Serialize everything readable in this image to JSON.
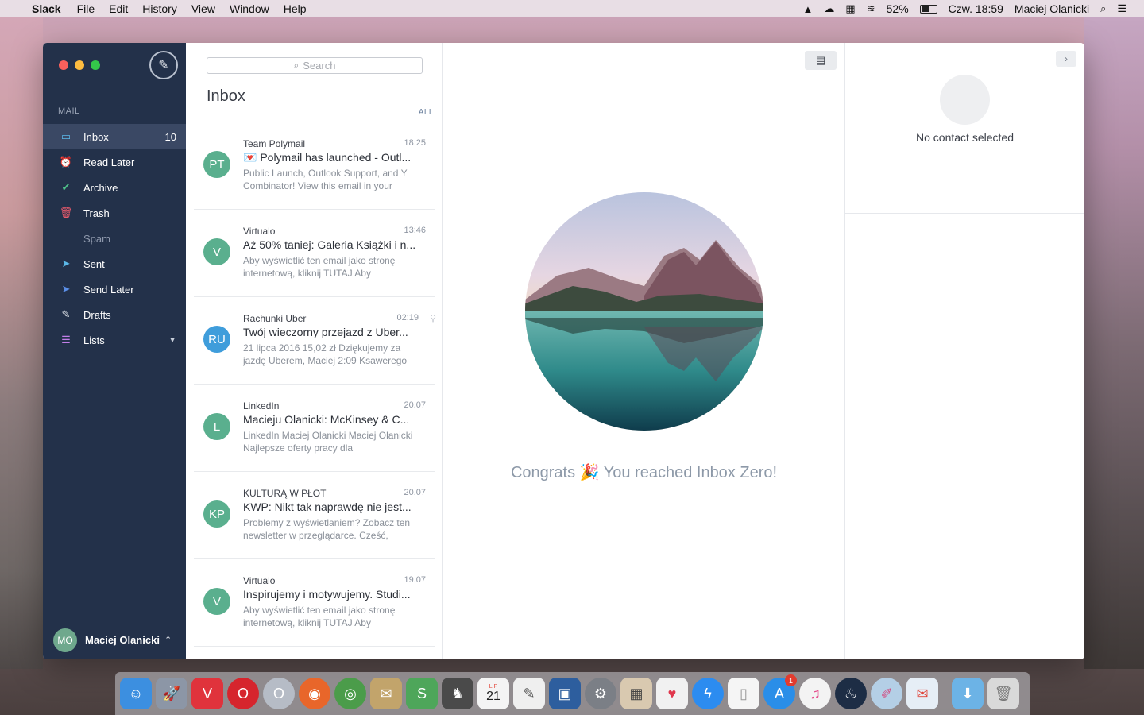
{
  "menubar": {
    "app_name": "Slack",
    "menus": [
      "File",
      "Edit",
      "History",
      "View",
      "Window",
      "Help"
    ],
    "battery_percent": "52%",
    "clock": "Czw. 18:59",
    "user": "Maciej Olanicki"
  },
  "sidebar": {
    "heading": "MAIL",
    "items": [
      {
        "label": "Inbox",
        "icon": "inbox-icon",
        "count": "10"
      },
      {
        "label": "Read Later",
        "icon": "alarm-clock-icon"
      },
      {
        "label": "Archive",
        "icon": "checkmark-icon"
      },
      {
        "label": "Trash",
        "icon": "trash-icon"
      },
      {
        "label": "Spam",
        "icon": ""
      },
      {
        "label": "Sent",
        "icon": "paper-plane-icon"
      },
      {
        "label": "Send Later",
        "icon": "scheduled-send-icon"
      },
      {
        "label": "Drafts",
        "icon": "pencil-icon"
      },
      {
        "label": "Lists",
        "icon": "list-icon"
      }
    ],
    "footer": {
      "initials": "MO",
      "name": "Maciej Olanicki"
    }
  },
  "list": {
    "search_placeholder": "Search",
    "title": "Inbox",
    "filter": "ALL",
    "messages": [
      {
        "initials": "PT",
        "sender": "Team Polymail",
        "time": "18:25",
        "subject": "💌 Polymail has launched - Outl...",
        "preview": "Public Launch, Outlook Support, and Y Combinator! View this email in your",
        "color": "#5aaf8e"
      },
      {
        "initials": "V",
        "sender": "Virtualo",
        "time": "13:46",
        "subject": "Aż 50% taniej: Galeria Książki i n...",
        "preview": "Aby wyświetlić ten email jako stronę internetową, kliknij TUTAJ Aby",
        "color": "#5aaf8e"
      },
      {
        "initials": "RU",
        "sender": "Rachunki Uber",
        "time": "02:19",
        "subject": "Twój wieczorny przejazd z Uber...",
        "preview": "21 lipca 2016 15,02 zł Dziękujemy za jazdę Uberem, Maciej 2:09 Ksawerego",
        "color": "#3f9ddb"
      },
      {
        "initials": "L",
        "sender": "LinkedIn",
        "time": "20.07",
        "subject": "Macieju Olanicki: McKinsey & C...",
        "preview": "LinkedIn Maciej Olanicki Maciej Olanicki Najlepsze oferty pracy dla",
        "color": "#5aaf8e"
      },
      {
        "initials": "KP",
        "sender": "KULTURĄ W PŁOT",
        "time": "20.07",
        "subject": "KWP: Nikt tak naprawdę nie jest...",
        "preview": "Problemy z wyświetlaniem? Zobacz ten newsletter w przeglądarce. Cześć,",
        "color": "#5aaf8e"
      },
      {
        "initials": "V",
        "sender": "Virtualo",
        "time": "19.07",
        "subject": "Inspirujemy i motywujemy. Studi...",
        "preview": "Aby wyświetlić ten email jako stronę internetową, kliknij TUTAJ Aby",
        "color": "#5aaf8e"
      }
    ]
  },
  "reading": {
    "congrats_text": "Congrats 🎉 You reached Inbox Zero!"
  },
  "contact": {
    "label": "No contact selected"
  },
  "dock": {
    "calendar_month": "LIP",
    "calendar_day": "21",
    "app_store_badge": "1"
  }
}
